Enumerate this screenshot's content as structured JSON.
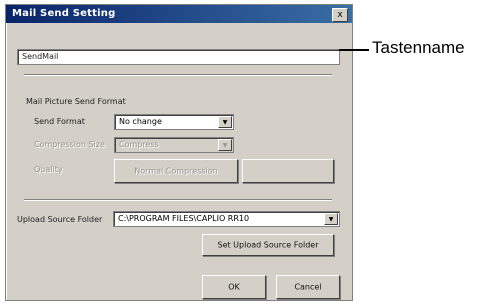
{
  "dialog": {
    "title": "Mail Send Setting",
    "close_label": "x",
    "name_field": {
      "value": "SendMail"
    },
    "group_title": "Mail Picture Send Format",
    "send_format": {
      "label": "Send Format",
      "value": "No change"
    },
    "size_row": {
      "label": "Compression Size",
      "value": "Compress"
    },
    "quality_row": {
      "label": "Quality",
      "value": "Normal Compression",
      "button_label": ""
    },
    "upload_folder": {
      "label": "Upload Source Folder",
      "value": "C:\\PROGRAM FILES\\CAPLIO RR10"
    },
    "set_upload_button": "Set Upload Source Folder",
    "ok_button": "OK",
    "cancel_button": "Cancel"
  },
  "callout": {
    "label": "Tastenname"
  }
}
